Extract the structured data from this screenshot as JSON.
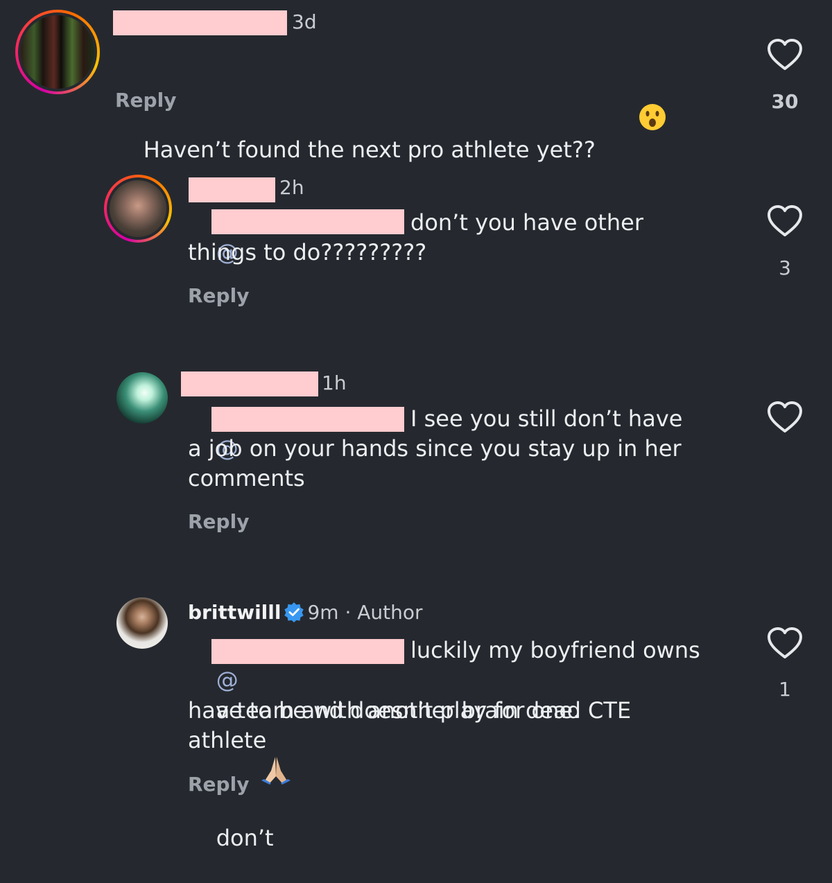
{
  "comments": [
    {
      "time": "3d",
      "text": "Haven’t found the next pro athlete yet??",
      "emoji": "😮",
      "reply_label": "Reply",
      "likes": "30"
    },
    {
      "time": "2h",
      "mention": "@",
      "text_line1": "don’t you have other",
      "text_line2": "things to do?????????",
      "reply_label": "Reply",
      "likes": "3"
    },
    {
      "time": "1h",
      "mention": "@",
      "text_line1": "I see you still don’t have",
      "text_line2": "a job on your hands since you stay up in her",
      "text_line3": "comments",
      "reply_label": "Reply",
      "likes": ""
    },
    {
      "username": "brittwilll",
      "time": "9m · Author",
      "mention": "@",
      "text_line1": "luckily my boyfriend owns",
      "text_line2a": "a team and doesn’t play for one.",
      "emoji": "🙏",
      "text_line2b": "don’t",
      "text_line3": "have to be with another brain dead CTE",
      "text_line4": "athlete",
      "reply_label": "Reply",
      "likes": "1"
    }
  ],
  "colors": {
    "background": "#25292f",
    "redaction": "#ffcccf",
    "mention": "#9fb0d6",
    "verified": "#3897f0"
  },
  "icons": [
    "heart-outline-icon",
    "verified-badge-icon"
  ]
}
